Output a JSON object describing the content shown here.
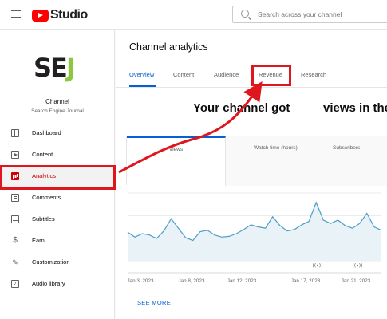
{
  "app": {
    "name": "Studio"
  },
  "search": {
    "placeholder": "Search across your channel"
  },
  "channel": {
    "logo_text": {
      "s": "S",
      "e": "E",
      "j": "J"
    },
    "name": "Channel",
    "subtitle": "Search Engine Journal"
  },
  "sidebar": {
    "items": [
      {
        "label": "Dashboard",
        "icon": "dashboard-icon"
      },
      {
        "label": "Content",
        "icon": "content-icon"
      },
      {
        "label": "Analytics",
        "icon": "analytics-icon",
        "active": true
      },
      {
        "label": "Comments",
        "icon": "comments-icon"
      },
      {
        "label": "Subtitles",
        "icon": "subtitles-icon"
      },
      {
        "label": "Earn",
        "icon": "earn-icon"
      },
      {
        "label": "Customization",
        "icon": "customization-icon"
      },
      {
        "label": "Audio library",
        "icon": "audio-library-icon"
      }
    ]
  },
  "main": {
    "title": "Channel analytics",
    "tabs": [
      {
        "label": "Overview",
        "active": true
      },
      {
        "label": "Content"
      },
      {
        "label": "Audience"
      },
      {
        "label": "Revenue",
        "highlighted": true
      },
      {
        "label": "Research"
      }
    ],
    "headline_left": "Your channel got",
    "headline_right": "views in the",
    "metrics": [
      {
        "label": "Views",
        "active": true
      },
      {
        "label": "Watch time (hours)"
      },
      {
        "label": "Subscribers"
      }
    ],
    "see_more": "SEE MORE"
  },
  "colors": {
    "accent": "#065fd4",
    "brand_red": "#ff0000",
    "highlight_red": "#e0161e",
    "chart_line": "#4d9ec7",
    "chart_fill": "#e8f2f7",
    "sej_green": "#8dc63f"
  },
  "chart_data": {
    "type": "area",
    "x": [
      "Jan 3, 2023",
      "Jan 8, 2023",
      "Jan 12, 2023",
      "Jan 17, 2023",
      "Jan 21, 2023"
    ],
    "series": [
      {
        "values": [
          0.42,
          0.35,
          0.4,
          0.38,
          0.33,
          0.44,
          0.62,
          0.48,
          0.34,
          0.3,
          0.43,
          0.45,
          0.38,
          0.35,
          0.36,
          0.4,
          0.46,
          0.53,
          0.5,
          0.48,
          0.65,
          0.52,
          0.44,
          0.46,
          0.53,
          0.58,
          0.86,
          0.6,
          0.55,
          0.6,
          0.52,
          0.48,
          0.55,
          0.7,
          0.5,
          0.45
        ]
      }
    ],
    "xlabel": "",
    "ylabel": ""
  }
}
